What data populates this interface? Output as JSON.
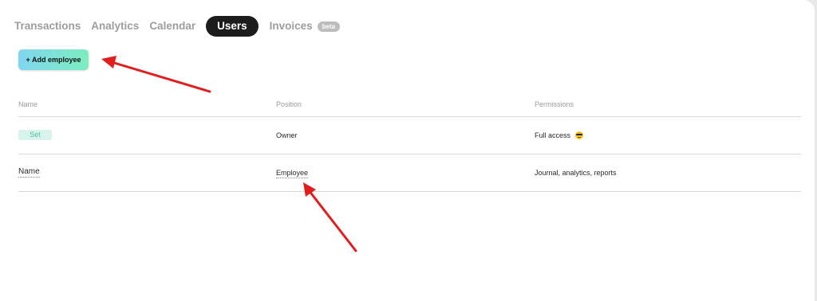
{
  "tabs": [
    {
      "label": "Transactions"
    },
    {
      "label": "Analytics"
    },
    {
      "label": "Calendar"
    },
    {
      "label": "Users",
      "active": true
    },
    {
      "label": "Invoices",
      "badge": "beta"
    }
  ],
  "add_button": {
    "label": "+ Add employee"
  },
  "table": {
    "headers": [
      "Name",
      "Position",
      "Permissions"
    ],
    "rows": [
      {
        "name": "Set",
        "position": "Owner",
        "permissions": "Full access"
      },
      {
        "name": "Name",
        "position": "Employee",
        "permissions": "Journal, analytics, reports"
      }
    ]
  },
  "icons": {
    "permission_emoji": "sunglasses-emoji-icon",
    "annotation": "red-arrow-icon"
  },
  "colors": {
    "active_tab_bg": "#1c1c1c",
    "button_gradient_start": "#7fd6ef",
    "button_gradient_end": "#7ceec0",
    "chip_bg": "#d8f3ec",
    "chip_text": "#4fbf9a",
    "annotation": "#e11d1d"
  }
}
